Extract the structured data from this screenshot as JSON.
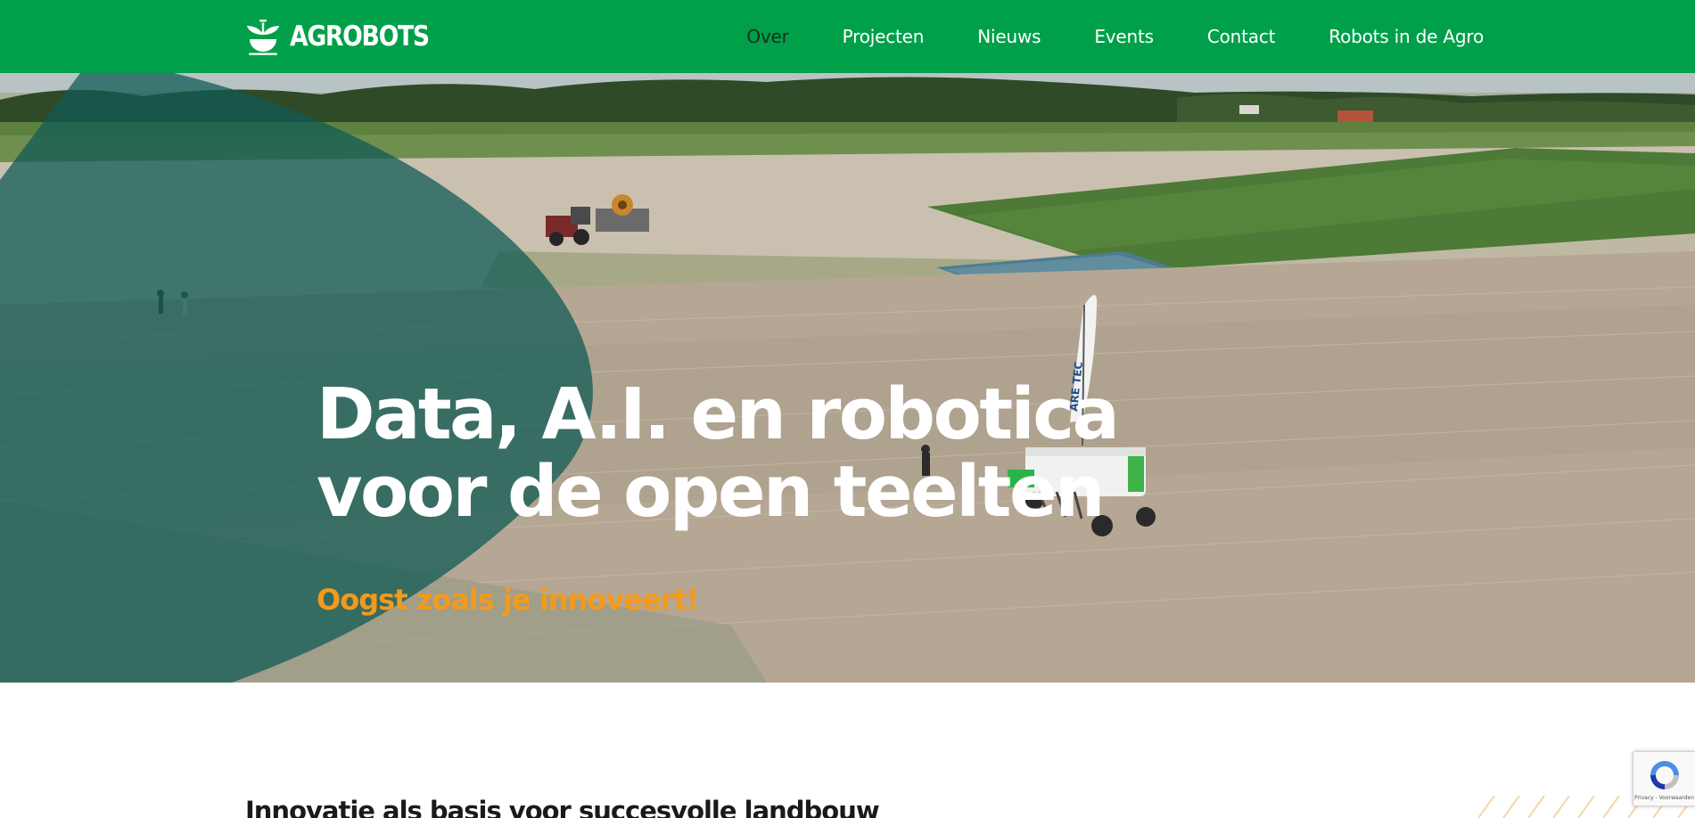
{
  "brand": {
    "name": "AGROBOTS"
  },
  "nav": {
    "items": [
      {
        "label": "Over",
        "active": true
      },
      {
        "label": "Projecten",
        "active": false
      },
      {
        "label": "Nieuws",
        "active": false
      },
      {
        "label": "Events",
        "active": false
      },
      {
        "label": "Contact",
        "active": false
      },
      {
        "label": "Robots in de Agro",
        "active": false
      }
    ]
  },
  "hero": {
    "title_line1": "Data, A.I. en robotica",
    "title_line2": "voor de open teelten",
    "subtitle": "Oogst zoals je innoveert!",
    "banner_text": "ARE TEC"
  },
  "section": {
    "title": "Innovatie als basis voor succesvolle landbouw"
  },
  "recaptcha": {
    "label": "Privacy - Voorwaarden"
  },
  "colors": {
    "brand_green": "#00a04a",
    "overlay_teal": "#0f5a55",
    "accent_orange": "#f39a1d",
    "nav_active": "#1c2b1f"
  }
}
